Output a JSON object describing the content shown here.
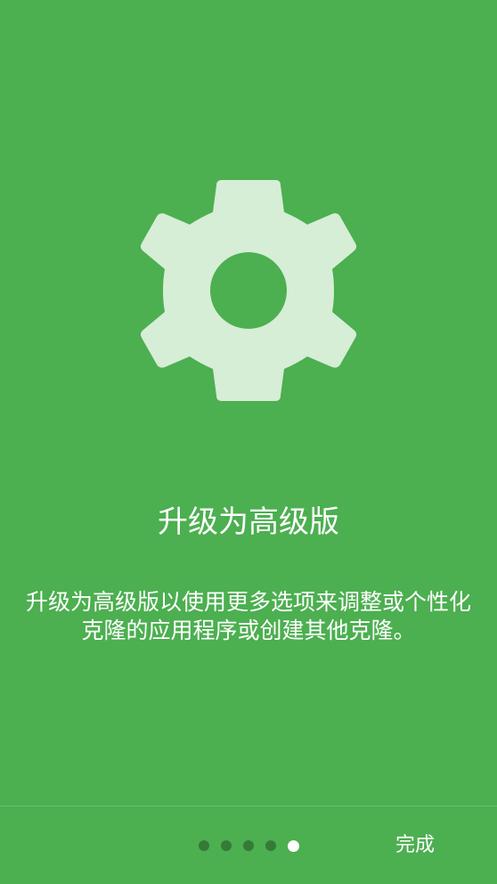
{
  "slide": {
    "icon": "settings-gear-icon",
    "title": "升级为高级版",
    "description": "升级为高级版以使用更多选项来调整或个性化克隆的应用程序或创建其他克隆。"
  },
  "pager": {
    "total": 5,
    "current": 5
  },
  "footer": {
    "done_label": "完成"
  },
  "colors": {
    "background": "#4CAF50",
    "icon": "#D6EDD6",
    "text": "#FFFFFF",
    "dot_inactive": "#2E6B31",
    "dot_active": "#FFFFFF"
  }
}
